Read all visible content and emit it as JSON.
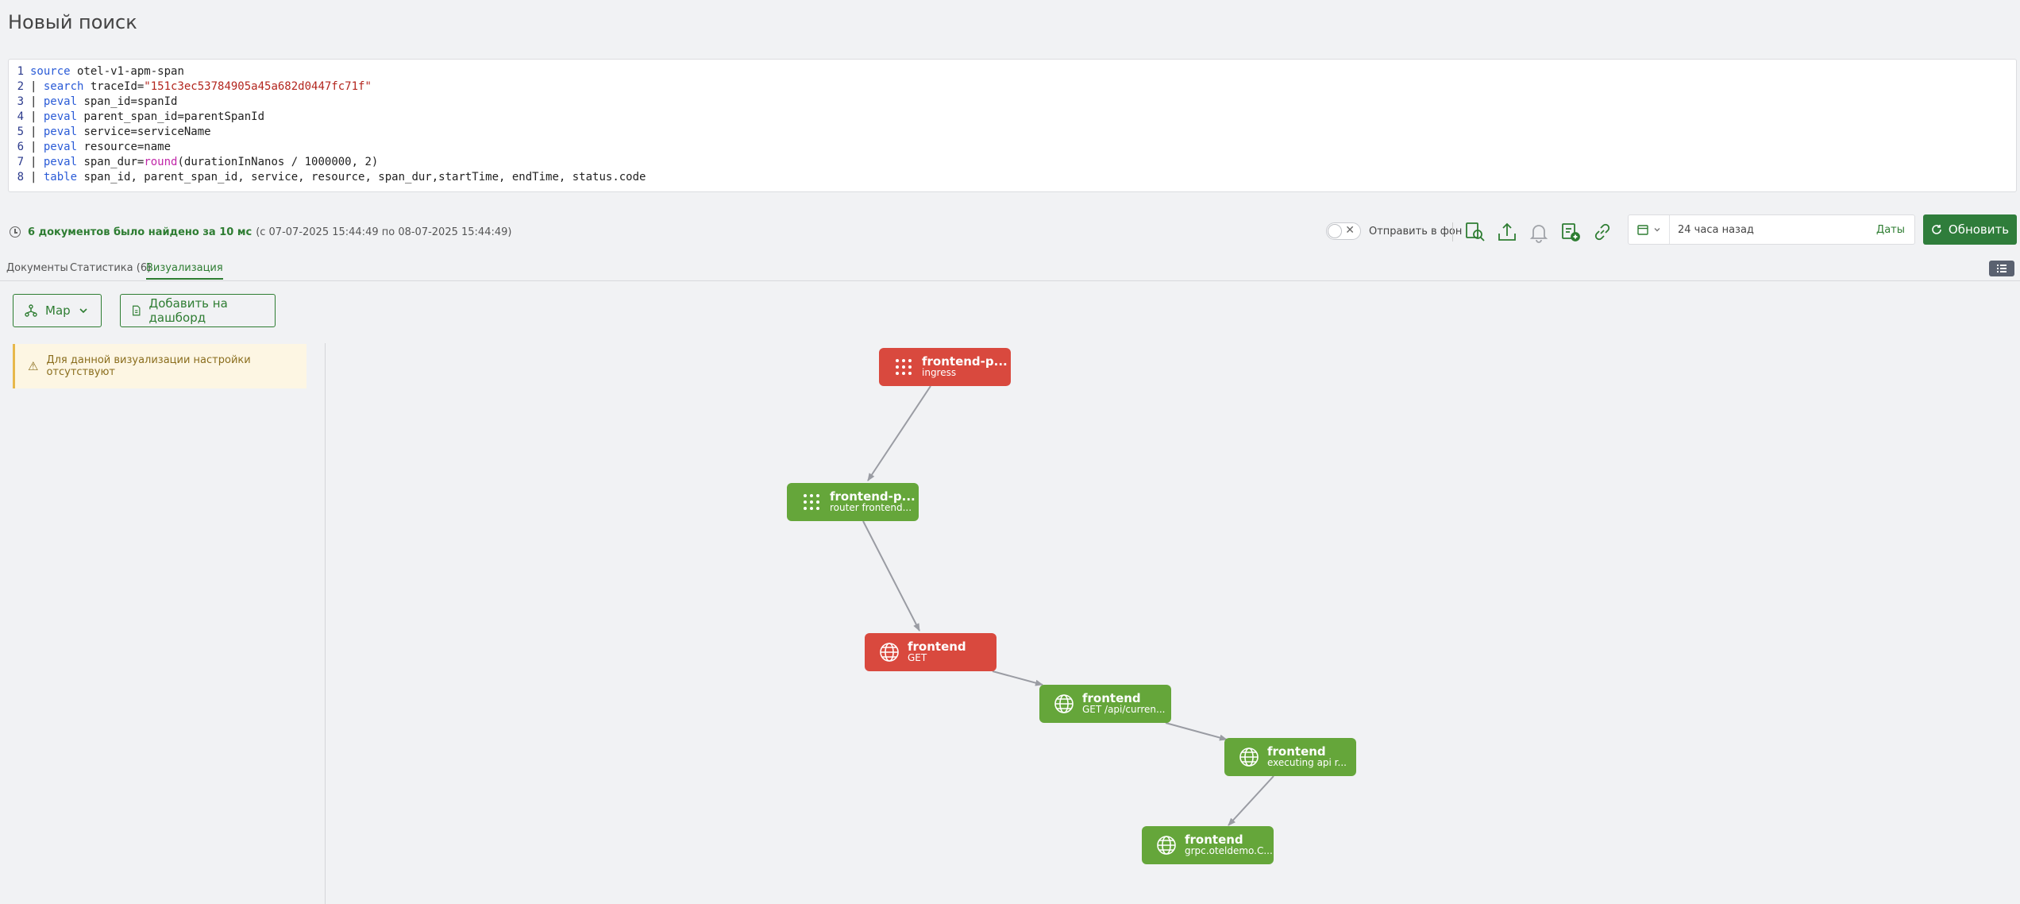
{
  "page": {
    "title": "Новый поиск"
  },
  "query": {
    "lines": [
      {
        "num": "1",
        "kw": "source",
        "rest": " otel-v1-apm-span"
      },
      {
        "num": "2",
        "prefix": "| ",
        "kw": "search",
        "rest": " traceId=",
        "str": "\"151c3ec53784905a45a682d0447fc71f\""
      },
      {
        "num": "3",
        "prefix": "| ",
        "kw": "peval",
        "rest": " span_id=spanId"
      },
      {
        "num": "4",
        "prefix": "| ",
        "kw": "peval",
        "rest": " parent_span_id=parentSpanId"
      },
      {
        "num": "5",
        "prefix": "| ",
        "kw": "peval",
        "rest": " service=serviceName"
      },
      {
        "num": "6",
        "prefix": "| ",
        "kw": "peval",
        "rest": " resource=name"
      },
      {
        "num": "7",
        "prefix": "| ",
        "kw": "peval",
        "rest": " span_dur=",
        "fn": "round",
        "tail": "(durationInNanos / 1000000, 2)"
      },
      {
        "num": "8",
        "prefix": "| ",
        "kw": "table",
        "rest": " span_id, parent_span_id, service, resource, span_dur,startTime, endTime, status.code"
      }
    ]
  },
  "status": {
    "found": "6 документов было найдено за 10 мс",
    "range": "(с 07-07-2025 15:44:49 по 08-07-2025 15:44:49)"
  },
  "toolbar": {
    "background_label": "Отправить в фон",
    "icons": [
      "inspect-search-icon",
      "export-upload-icon",
      "alert-bell-icon",
      "add-to-list-icon",
      "link-icon"
    ],
    "time_range": "24 часа назад",
    "dates_label": "Даты",
    "refresh_label": "Обновить"
  },
  "tabs": [
    {
      "label": "Документы",
      "active": false
    },
    {
      "label": "Статистика (6)",
      "active": false
    },
    {
      "label": "Визуализация",
      "active": true
    }
  ],
  "viz": {
    "type_label": "Map",
    "dashboard_label": "Добавить на дашборд",
    "warning": "Для данной визуализации настройки отсутствуют"
  },
  "graph": {
    "nodes": [
      {
        "name": "frontend-p...",
        "op": "ingress",
        "status": "error",
        "icon": "grid-dots-icon"
      },
      {
        "name": "frontend-p...",
        "op": "router frontend...",
        "status": "ok",
        "icon": "grid-dots-icon"
      },
      {
        "name": "frontend",
        "op": "GET",
        "status": "error",
        "icon": "globe-icon"
      },
      {
        "name": "frontend",
        "op": "GET /api/curren...",
        "status": "ok",
        "icon": "globe-icon"
      },
      {
        "name": "frontend",
        "op": "executing api r...",
        "status": "ok",
        "icon": "globe-icon"
      },
      {
        "name": "frontend",
        "op": "grpc.oteldemo.C...",
        "status": "ok",
        "icon": "globe-icon"
      }
    ],
    "edges": [
      [
        0,
        1
      ],
      [
        1,
        2
      ],
      [
        2,
        3
      ],
      [
        3,
        4
      ],
      [
        4,
        5
      ]
    ],
    "colors": {
      "error": "#d9493e",
      "ok": "#65a63a",
      "edge": "#9a9ca3"
    }
  },
  "theme": {
    "accent": "#2e7d32"
  }
}
